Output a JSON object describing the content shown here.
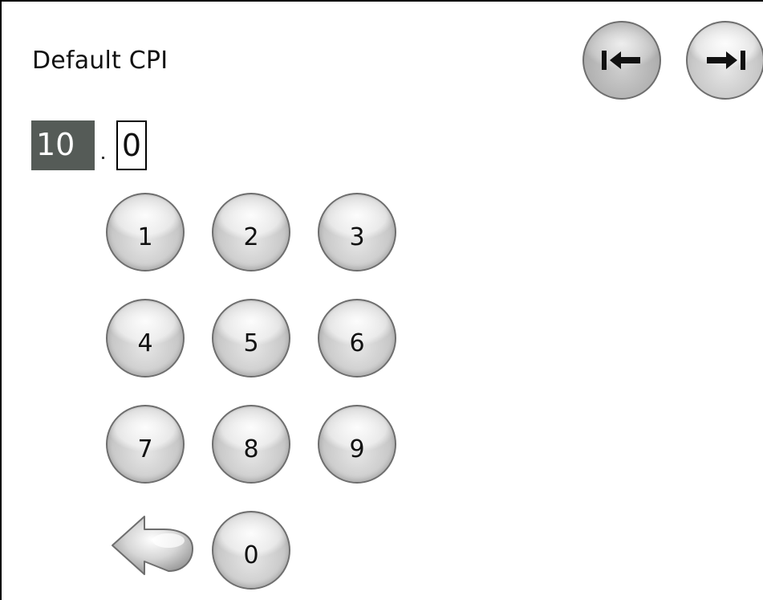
{
  "title": "Default CPI",
  "value": {
    "integer_part": "10",
    "fraction_part": "0"
  },
  "keypad": {
    "keys": [
      "1",
      "2",
      "3",
      "4",
      "5",
      "6",
      "7",
      "8",
      "9",
      "0"
    ]
  },
  "icons": {
    "nav_prev": "previous-icon",
    "nav_next": "next-icon",
    "backspace": "backspace-arrow-icon"
  },
  "colors": {
    "integer_field_bg": "#555b57",
    "integer_field_text": "#ffffff",
    "key_face": "#c8c8c8"
  }
}
